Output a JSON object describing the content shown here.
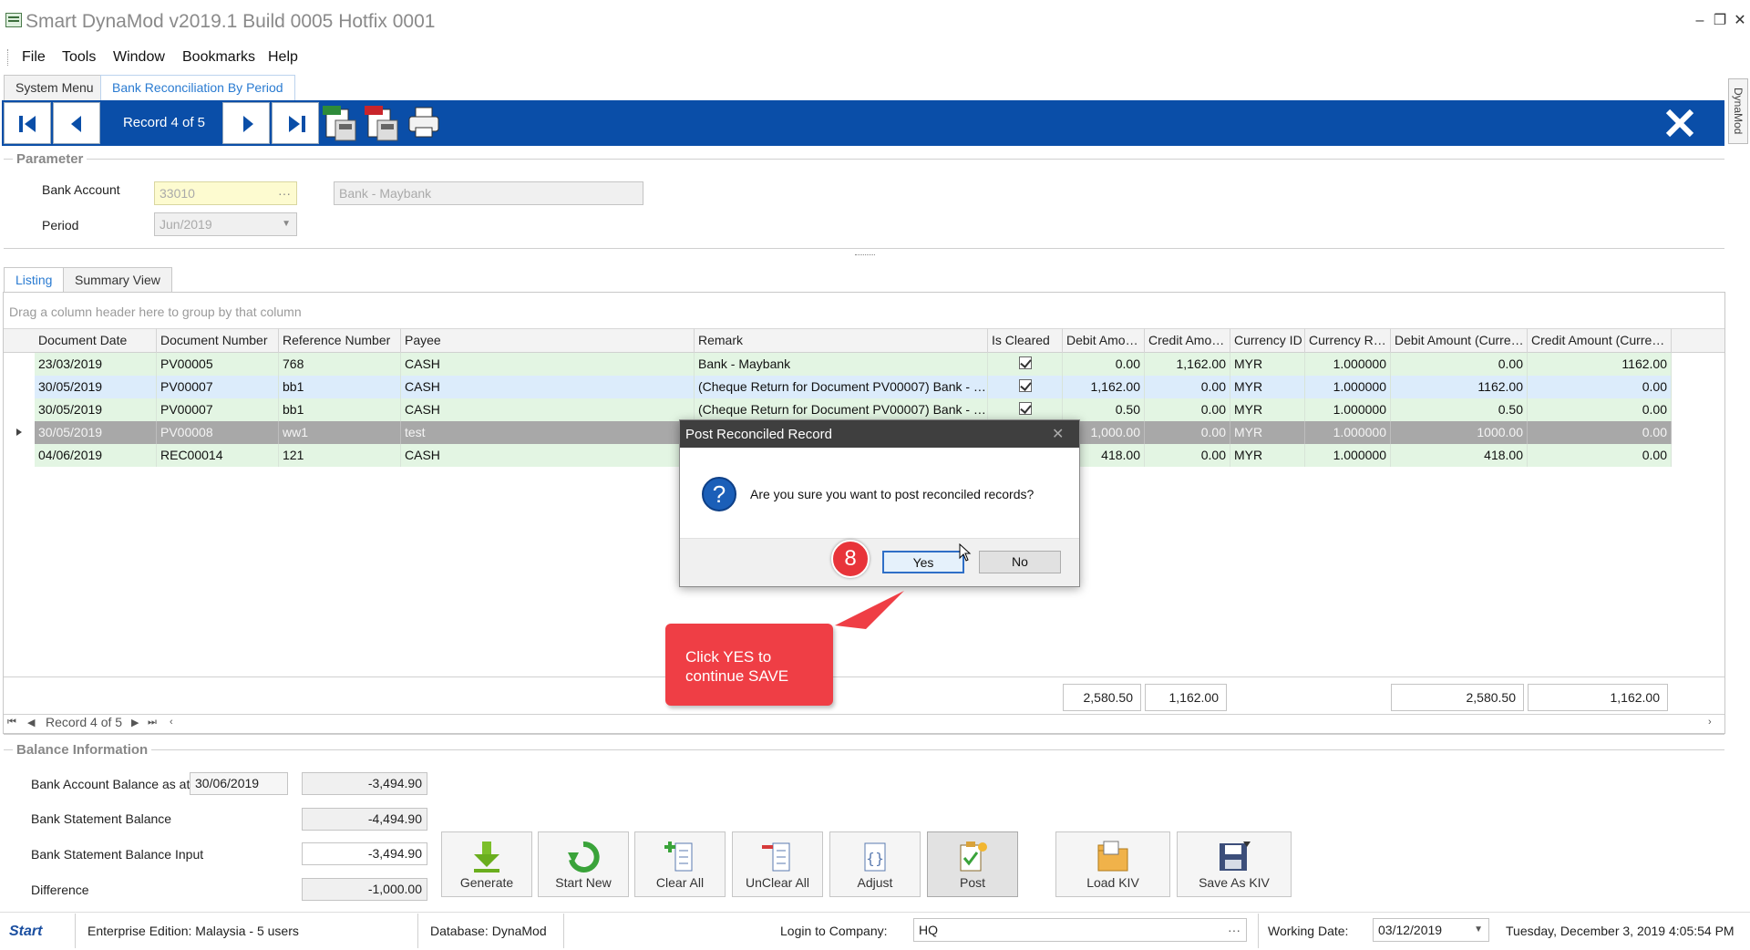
{
  "window": {
    "title": "Smart DynaMod v2019.1 Build 0005 Hotfix 0001"
  },
  "menu": {
    "items": [
      "File",
      "Tools",
      "Window",
      "Bookmarks",
      "Help"
    ]
  },
  "tabs": {
    "system_menu": "System Menu",
    "bank_reconciliation": "Bank Reconciliation By Period"
  },
  "side_tab": "DynaMod",
  "navigation": {
    "record_label": "Record 4 of 5"
  },
  "parameter": {
    "title": "Parameter",
    "bank_account_label": "Bank Account",
    "bank_account_code": "33010",
    "bank_account_name": "Bank - Maybank",
    "period_label": "Period",
    "period_value": "Jun/2019"
  },
  "listing_tabs": {
    "listing": "Listing",
    "summary": "Summary View"
  },
  "grid": {
    "group_hint": "Drag a column header here to group by that column",
    "columns": [
      "Document Date",
      "Document Number",
      "Reference Number",
      "Payee",
      "Remark",
      "Is Cleared",
      "Debit Amo…",
      "Credit Amo…",
      "Currency ID",
      "Currency R…",
      "Debit Amount (Curre…",
      "Credit Amount (Curre…"
    ],
    "rows": [
      [
        "23/03/2019",
        "PV00005",
        "768",
        "CASH",
        "Bank - Maybank",
        "true",
        "0.00",
        "1,162.00",
        "MYR",
        "1.000000",
        "0.00",
        "1162.00"
      ],
      [
        "30/05/2019",
        "PV00007",
        "bb1",
        "CASH",
        "(Cheque Return for Document PV00007) Bank - …",
        "true",
        "1,162.00",
        "0.00",
        "MYR",
        "1.000000",
        "1162.00",
        "0.00"
      ],
      [
        "30/05/2019",
        "PV00007",
        "bb1",
        "CASH",
        "(Cheque Return for Document PV00007) Bank - …",
        "true",
        "0.50",
        "0.00",
        "MYR",
        "1.000000",
        "0.50",
        "0.00"
      ],
      [
        "30/05/2019",
        "PV00008",
        "ww1",
        "test",
        "",
        "",
        "1,000.00",
        "0.00",
        "MYR",
        "1.000000",
        "1000.00",
        "0.00"
      ],
      [
        "04/06/2019",
        "REC00014",
        "121",
        "CASH",
        "",
        "",
        "418.00",
        "0.00",
        "MYR",
        "1.000000",
        "418.00",
        "0.00"
      ]
    ],
    "totals": {
      "debit": "2,580.50",
      "credit": "1,162.00",
      "debit_curr": "2,580.50",
      "credit_curr": "1,162.00"
    },
    "pager_label": "Record 4 of 5"
  },
  "balance": {
    "title": "Balance Information",
    "account_balance_label": "Bank Account Balance as at",
    "account_balance_date": "30/06/2019",
    "account_balance_value": "-3,494.90",
    "statement_balance_label": "Bank Statement Balance",
    "statement_balance_value": "-4,494.90",
    "statement_input_label": "Bank Statement Balance Input",
    "statement_input_value": "-3,494.90",
    "difference_label": "Difference",
    "difference_value": "-1,000.00"
  },
  "actions": {
    "generate": "Generate",
    "start_new": "Start New",
    "clear_all": "Clear All",
    "unclear_all": "UnClear All",
    "adjust": "Adjust",
    "post": "Post",
    "load_kiv": "Load KIV",
    "save_kiv": "Save As KIV"
  },
  "status": {
    "logo": "Start",
    "edition": "Enterprise Edition: Malaysia - 5 users",
    "database": "Database: DynaMod",
    "login_label": "Login to Company:",
    "company": "HQ",
    "working_date_label": "Working Date:",
    "working_date": "03/12/2019",
    "datetime": "Tuesday, December 3, 2019 4:05:54 PM"
  },
  "dialog": {
    "title": "Post Reconciled Record",
    "message": "Are you sure you want to post reconciled records?",
    "yes": "Yes",
    "no": "No"
  },
  "annotation": {
    "step": "8",
    "callout": "Click YES to continue SAVE"
  },
  "colors": {
    "nav_bar": "#0a4ea8",
    "row_green": "#e3f5e3",
    "row_blue": "#dcecfb",
    "row_selected": "#a8a8a8",
    "callout": "#ef3e45"
  }
}
